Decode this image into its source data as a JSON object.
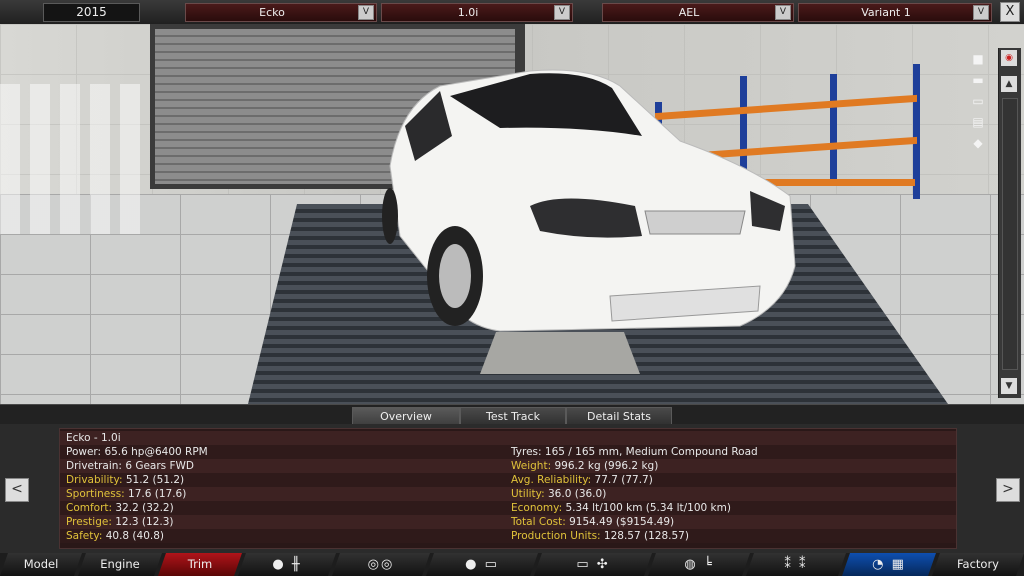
{
  "topbar": {
    "year": "2015",
    "model": "Ecko",
    "engine": "1.0i",
    "trim": "AEL",
    "variant": "Variant 1",
    "dropdown_arrow": "V",
    "close": "X"
  },
  "scene_icons": [
    "camera-icon",
    "eye-icon",
    "car-front-icon",
    "car-side-icon",
    "car-top-icon",
    "car-rear-icon"
  ],
  "tabs": [
    "Overview",
    "Test Track",
    "Detail Stats"
  ],
  "info": {
    "title": "Ecko - 1.0i",
    "left": [
      {
        "k": "Power: ",
        "v": "65.6 hp@6400 RPM",
        "hl": false
      },
      {
        "k": "Drivetrain: ",
        "v": "6 Gears FWD",
        "hl": false
      },
      {
        "k": "Drivability: ",
        "v": "51.2 (51.2)",
        "hl": true
      },
      {
        "k": "Sportiness: ",
        "v": "17.6 (17.6)",
        "hl": true
      },
      {
        "k": "Comfort: ",
        "v": "32.2 (32.2)",
        "hl": true
      },
      {
        "k": "Prestige: ",
        "v": "12.3 (12.3)",
        "hl": true
      },
      {
        "k": "Safety: ",
        "v": "40.8 (40.8)",
        "hl": true
      }
    ],
    "right": [
      {
        "k": "Tyres: ",
        "v": "165 / 165 mm, Medium Compound Road",
        "hl": false
      },
      {
        "k": "Weight: ",
        "v": "996.2 kg (996.2 kg)",
        "hl": true
      },
      {
        "k": "Avg. Reliability: ",
        "v": "77.7 (77.7)",
        "hl": true
      },
      {
        "k": "Utility: ",
        "v": "36.0 (36.0)",
        "hl": true
      },
      {
        "k": "Economy: ",
        "v": "5.34 lt/100 km (5.34 lt/100 km)",
        "hl": true
      },
      {
        "k": "Total Cost: ",
        "v": "9154.49 ($9154.49)",
        "hl": true
      },
      {
        "k": "Production Units: ",
        "v": "128.57 (128.57)",
        "hl": true
      }
    ]
  },
  "nav_prev": "<",
  "nav_next": ">",
  "bottom_nav": {
    "model": "Model",
    "engine": "Engine",
    "trim": "Trim",
    "factory": "Factory"
  },
  "colors": {
    "highlight": "#e0c23a",
    "active_tab": "#b0141a",
    "blue_tab": "#0e4fb0"
  }
}
